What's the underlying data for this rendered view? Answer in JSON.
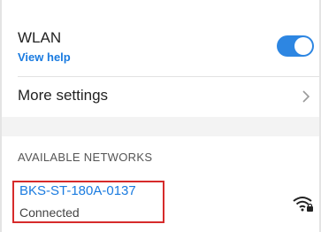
{
  "wlan": {
    "title": "WLAN",
    "help_link": "View help",
    "toggle_state": "on"
  },
  "more_settings": {
    "label": "More settings",
    "icon": "chevron-right-icon"
  },
  "available_networks": {
    "header": "AVAILABLE NETWORKS",
    "networks": [
      {
        "name": "BKS-ST-180A-0137",
        "status": "Connected",
        "icon": "wifi-locked-icon"
      }
    ]
  },
  "colors": {
    "accent": "#1a7be0",
    "toggle": "#2d86e2",
    "highlight": "#d62b2b"
  }
}
